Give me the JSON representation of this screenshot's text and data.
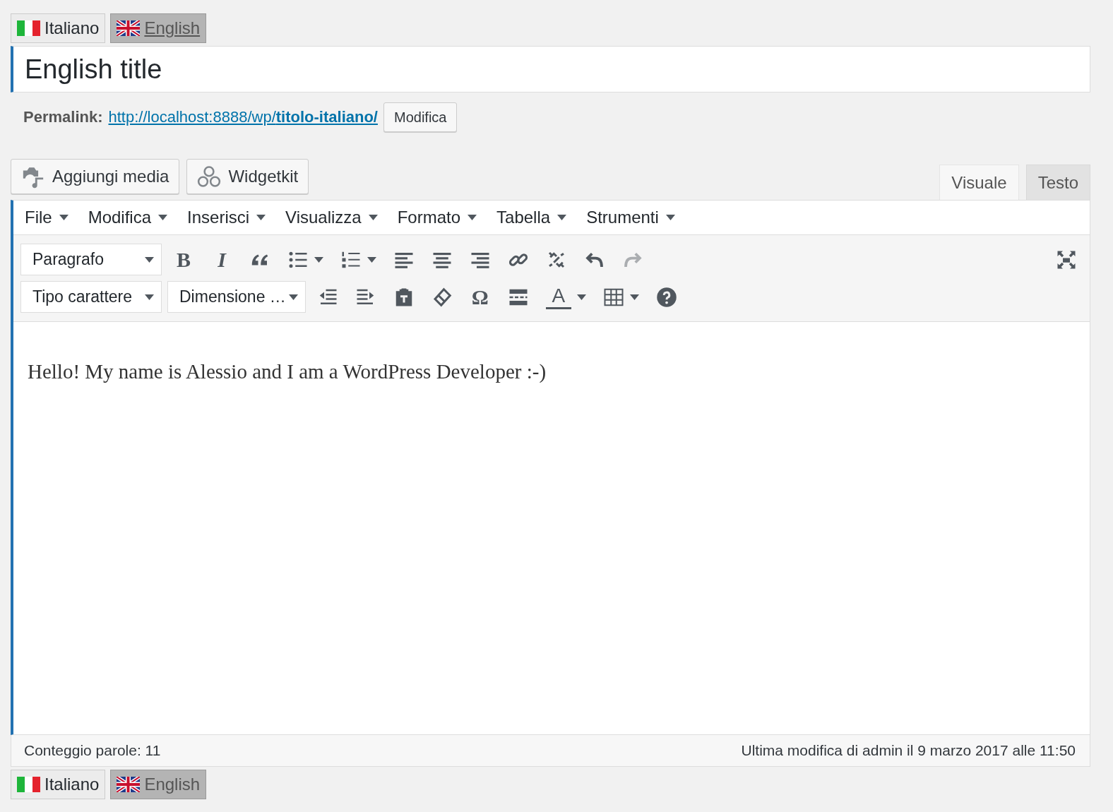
{
  "languages_top": [
    {
      "kind": "it",
      "label": "Italiano",
      "selected": false
    },
    {
      "kind": "gb",
      "label": "English",
      "selected": true
    }
  ],
  "title_field": {
    "value": "English title"
  },
  "permalink": {
    "label": "Permalink:",
    "url_base": "http://localhost:8888/wp/",
    "slug": "titolo-italiano/",
    "button": "Modifica"
  },
  "media_buttons": [
    {
      "kind": "media",
      "label": "Aggiungi media"
    },
    {
      "kind": "widget",
      "label": "Widgetkit"
    }
  ],
  "editor_tabs": [
    {
      "label": "Visuale",
      "selected": true
    },
    {
      "label": "Testo",
      "selected": false
    }
  ],
  "menubar": [
    "File",
    "Modifica",
    "Inserisci",
    "Visualizza",
    "Formato",
    "Tabella",
    "Strumenti"
  ],
  "toolbar_row_1": [
    {
      "kind": "select",
      "label": "Paragrafo"
    },
    {
      "kind": "bold",
      "glyph": "B",
      "split": false,
      "disabled": false
    },
    {
      "kind": "italic",
      "glyph": "I",
      "split": false,
      "disabled": false
    },
    {
      "kind": "quote",
      "split": false,
      "disabled": false
    },
    {
      "kind": "bullist",
      "split": true,
      "disabled": false
    },
    {
      "kind": "numlist",
      "split": true,
      "disabled": false
    },
    {
      "kind": "alignleft",
      "split": false,
      "disabled": false
    },
    {
      "kind": "aligncenter",
      "split": false,
      "disabled": false
    },
    {
      "kind": "alignright",
      "split": false,
      "disabled": false
    },
    {
      "kind": "link",
      "split": false,
      "disabled": false
    },
    {
      "kind": "unlink",
      "split": false,
      "disabled": false
    },
    {
      "kind": "undo",
      "split": false,
      "disabled": false
    },
    {
      "kind": "redo",
      "split": false,
      "disabled": true
    }
  ],
  "toolbar_row_2": [
    {
      "kind": "select",
      "label": "Tipo carattere"
    },
    {
      "kind": "select",
      "label": "Dimensione …"
    },
    {
      "kind": "outdent",
      "split": false,
      "disabled": false
    },
    {
      "kind": "indent",
      "split": false,
      "disabled": false
    },
    {
      "kind": "paste",
      "split": false,
      "disabled": false
    },
    {
      "kind": "eraser",
      "split": false,
      "disabled": false
    },
    {
      "kind": "omega",
      "glyph": "Ω",
      "split": false,
      "disabled": false
    },
    {
      "kind": "readmore",
      "split": false,
      "disabled": false
    },
    {
      "kind": "forecolor",
      "glyph": "A",
      "split": true,
      "disabled": false
    },
    {
      "kind": "table",
      "split": true,
      "disabled": false
    },
    {
      "kind": "help",
      "split": false,
      "disabled": false
    }
  ],
  "content": "Hello! My name is Alessio and I am a WordPress Developer :-)",
  "status_bar": {
    "word_count": "Conteggio parole: 11",
    "last_modified": "Ultima modifica di admin il 9 marzo 2017 alle 11:50"
  },
  "languages_bottom": [
    {
      "kind": "it",
      "label": "Italiano",
      "selected": false
    },
    {
      "kind": "gb",
      "label": "English",
      "selected": true
    }
  ]
}
